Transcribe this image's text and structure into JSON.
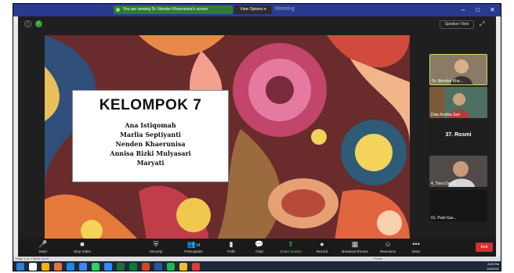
{
  "titlebar": {
    "share_notice": "You are viewing Dr. Nenden Khaerunisa's screen",
    "view_options": "View Options ▾",
    "ghost_title": "Meeting",
    "minimize": "–",
    "maximize": "□",
    "close": "✕"
  },
  "topbar": {
    "speaker_view": "Speaker View",
    "fullscreen": "⤢"
  },
  "slide": {
    "title": "KELOMPOK 7",
    "members": [
      "Ana Istiqomah",
      "Marlia Septiyanti",
      "Nenden Khaerunisa",
      "Annisa Rizki Mulyasari",
      "Maryati"
    ]
  },
  "gallery": {
    "tiles": [
      {
        "label": "Dr. Nenden Kha..."
      },
      {
        "label": "Dian Andika Sari"
      },
      {
        "label": "37. Rosmi"
      },
      {
        "label": "4_Tiara Dwi S..."
      },
      {
        "label": "01. Putri Gar..."
      }
    ],
    "scroll": "⌄"
  },
  "toolbar": {
    "items": [
      {
        "label": "Mute",
        "icon": "🎤"
      },
      {
        "label": "Stop Video",
        "icon": "■"
      },
      {
        "label": "Security",
        "icon": "⛨"
      },
      {
        "label": "Participants",
        "icon": "👥",
        "count": "14"
      },
      {
        "label": "Polls",
        "icon": "▮"
      },
      {
        "label": "Chat",
        "icon": "💬"
      },
      {
        "label": "Share Screen",
        "icon": "⇧"
      },
      {
        "label": "Record",
        "icon": "●"
      },
      {
        "label": "Breakout Rooms",
        "icon": "▦"
      },
      {
        "label": "Reactions",
        "icon": "☺"
      },
      {
        "label": "More",
        "icon": "•••"
      }
    ],
    "end": "End"
  },
  "statusbar": {
    "left": "Page 1 of 1     Word count",
    "right": "Focus"
  },
  "taskbar": {
    "time": "3:00 PM",
    "date": "3/3/2021"
  },
  "colors": {
    "accent_green": "#2e7d32",
    "end_red": "#d32f2f",
    "active_tile": "#c6e05a",
    "share_green": "#4caf50"
  }
}
